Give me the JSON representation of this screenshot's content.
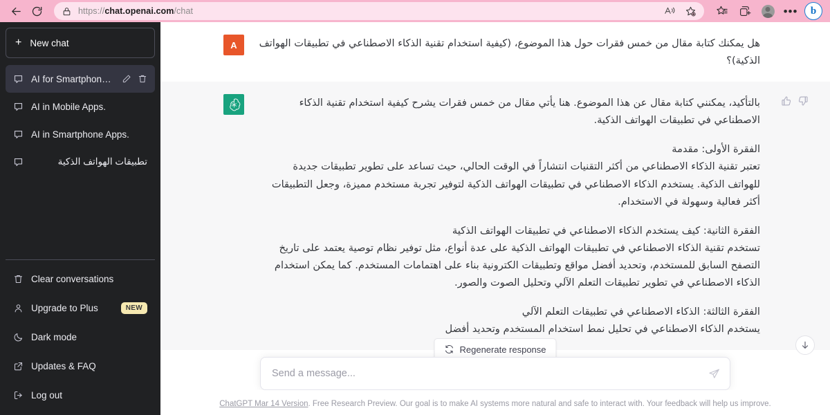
{
  "browser": {
    "back_label": "Back",
    "reload_label": "Refresh",
    "url_scheme": "https://",
    "url_host": "chat.openai.com",
    "url_path": "/chat",
    "read_aloud_label": "Read aloud",
    "favorite_label": "Add to favorites",
    "collections_label": "Collections",
    "split_screen_label": "Split screen",
    "profile_label": "Profile",
    "more_label": "Settings and more",
    "bing_label": "b",
    "chrome_color": "#f7b5cd",
    "url_pill_color": "#fde3ee"
  },
  "sidebar": {
    "new_chat_label": "New chat",
    "new_chat_plus": "+",
    "chats": [
      {
        "label": "AI for Smartphone App",
        "active": true,
        "rtl": false
      },
      {
        "label": "AI in Mobile Apps.",
        "active": false,
        "rtl": false
      },
      {
        "label": "AI in Smartphone Apps.",
        "active": false,
        "rtl": false
      },
      {
        "label": "تطبيقات الهواتف الذكية",
        "active": false,
        "rtl": true
      }
    ],
    "footer": [
      {
        "label": "Clear conversations",
        "icon": "trash-icon",
        "badge": ""
      },
      {
        "label": "Upgrade to Plus",
        "icon": "person-icon",
        "badge": "NEW"
      },
      {
        "label": "Dark mode",
        "icon": "moon-icon",
        "badge": ""
      },
      {
        "label": "Updates & FAQ",
        "icon": "external-link-icon",
        "badge": ""
      },
      {
        "label": "Log out",
        "icon": "logout-icon",
        "badge": ""
      }
    ],
    "background_color": "#202123",
    "active_color": "#343541"
  },
  "conversation": {
    "user": {
      "avatar_initial": "A",
      "avatar_color": "#e8562a",
      "text": "هل يمكنك كتابة مقال من خمس فقرات حول هذا الموضوع، (كيفية استخدام تقنية الذكاء الاصطناعي في تطبيقات الهواتف الذكية)؟"
    },
    "assistant": {
      "avatar_color": "#19a37f",
      "paragraphs": [
        "بالتأكيد، يمكنني كتابة مقال عن هذا الموضوع. هنا يأتي مقال من خمس فقرات يشرح كيفية استخدام تقنية الذكاء الاصطناعي في تطبيقات الهواتف الذكية.",
        "الفقرة الأولى: مقدمة\nتعتبر تقنية الذكاء الاصطناعي من أكثر التقنيات انتشاراً في الوقت الحالي، حيث تساعد على تطوير تطبيقات جديدة للهواتف الذكية. يستخدم الذكاء الاصطناعي في تطبيقات الهواتف الذكية لتوفير تجربة مستخدم مميزة، وجعل التطبيقات أكثر فعالية وسهولة في الاستخدام.",
        "الفقرة الثانية: كيف يستخدم الذكاء الاصطناعي في تطبيقات الهواتف الذكية\nتستخدم تقنية الذكاء الاصطناعي في تطبيقات الهواتف الذكية على عدة أنواع، مثل توفير نظام توصية يعتمد على تاريخ التصفح السابق للمستخدم، وتحديد أفضل مواقع وتطبيقات الكترونية بناء على اهتمامات المستخدم. كما يمكن استخدام الذكاء الاصطناعي في تطوير تطبيقات التعلم الآلي وتحليل الصوت والصور.",
        "الفقرة الثالثة: الذكاء الاصطناعي في تطبيقات التعلم الآلي\nيستخدم الذكاء الاصطناعي في تحليل نمط استخدام المستخدم وتحديد أفضل"
      ],
      "thumbs_up_label": "Good response",
      "thumbs_down_label": "Bad response"
    }
  },
  "actions": {
    "regenerate_label": "Regenerate response",
    "scroll_bottom_label": "Scroll to bottom"
  },
  "composer": {
    "placeholder": "Send a message...",
    "value": "",
    "send_label": "Send message"
  },
  "footer": {
    "link_text": "ChatGPT Mar 14 Version",
    "note_text": ". Free Research Preview. Our goal is to make AI systems more natural and safe to interact with. Your feedback will help us improve."
  }
}
